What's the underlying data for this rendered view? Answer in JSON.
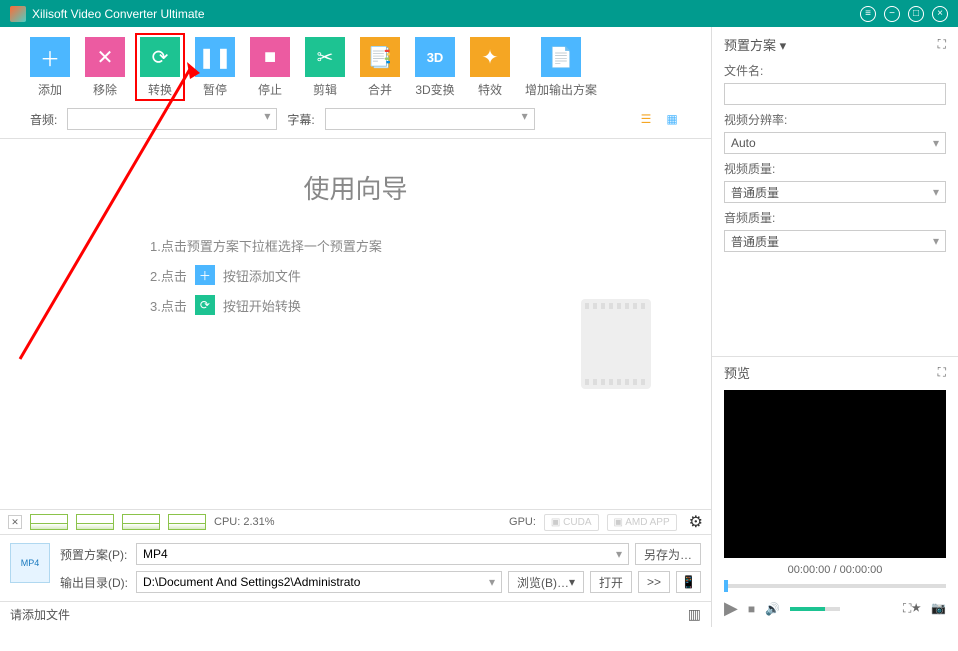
{
  "title": "Xilisoft Video Converter Ultimate",
  "toolbar": {
    "add": "添加",
    "remove": "移除",
    "convert": "转换",
    "pause": "暂停",
    "stop": "停止",
    "cut": "剪辑",
    "merge": "合并",
    "threeD": "3D变换",
    "fx": "特效",
    "addProfile": "增加输出方案"
  },
  "sub": {
    "audioLabel": "音频:",
    "subtitleLabel": "字幕:"
  },
  "wizard": {
    "title": "使用向导",
    "s1": "1.点击预置方案下拉框选择一个预置方案",
    "s2a": "2.点击",
    "s2b": "按钮添加文件",
    "s3a": "3.点击",
    "s3b": "按钮开始转换"
  },
  "perf": {
    "cpuLabel": "CPU: 2.31%",
    "gpuLabel": "GPU:",
    "cuda": "CUDA",
    "amd": "AMD APP"
  },
  "bottom": {
    "profileLabel": "预置方案(P):",
    "profileValue": "MP4",
    "saveAs": "另存为…",
    "destLabel": "输出目录(D):",
    "destValue": "D:\\Document And Settings2\\Administrato",
    "browse": "浏览(B)…",
    "open": "打开",
    "moreOpts": ">>"
  },
  "status": {
    "msg": "请添加文件"
  },
  "preset": {
    "header": "预置方案",
    "filename": "文件名:",
    "resolution": "视频分辨率:",
    "resolutionVal": "Auto",
    "vq": "视频质量:",
    "vqVal": "普通质量",
    "aq": "音频质量:",
    "aqVal": "普通质量"
  },
  "preview": {
    "header": "预览",
    "time": "00:00:00 / 00:00:00"
  }
}
